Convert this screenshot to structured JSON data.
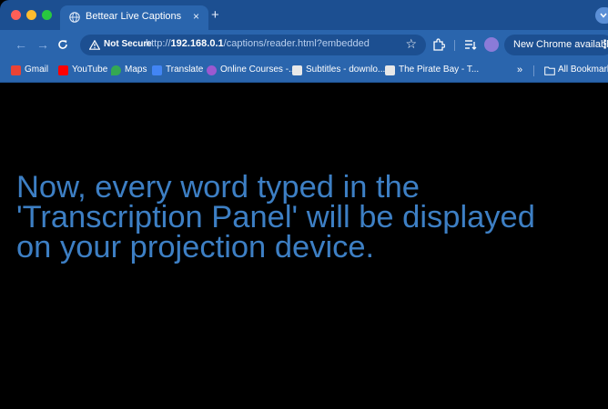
{
  "tab": {
    "title": "Bettear Live Captions",
    "close_glyph": "×",
    "new_tab_glyph": "+"
  },
  "toolbar": {
    "security_label": "Not Secure",
    "url_scheme": "http://",
    "url_host": "192.168.0.1",
    "url_path": "/captions/reader.html?embedded",
    "update_label": "New Chrome available",
    "menu_glyph": "⋮"
  },
  "bookmarks": [
    {
      "label": "Gmail",
      "icon": "gmail-icon",
      "color": "#ea4335"
    },
    {
      "label": "YouTube",
      "icon": "youtube-icon",
      "color": "#ff0000"
    },
    {
      "label": "Maps",
      "icon": "maps-icon",
      "color": "#34a853"
    },
    {
      "label": "Translate",
      "icon": "translate-icon",
      "color": "#4285f4"
    },
    {
      "label": "Online Courses -...",
      "icon": "courses-icon",
      "color": "#9b59d0"
    },
    {
      "label": "Subtitles - downlo...",
      "icon": "subtitles-icon",
      "color": "#e8e8e8"
    },
    {
      "label": "The Pirate Bay - T...",
      "icon": "piratebay-icon",
      "color": "#e8e8e8"
    }
  ],
  "bookmarks_more": "»",
  "all_bookmarks": "All Bookmarks",
  "caption": {
    "lines": [
      "Now, every word typed in the",
      "'Transcription Panel' will be displayed",
      "on your projection device."
    ],
    "color": "#3d7fc4"
  },
  "theme": {
    "chrome_dark": "#1c4f91",
    "chrome_light": "#2a65ad",
    "background": "#000000"
  }
}
